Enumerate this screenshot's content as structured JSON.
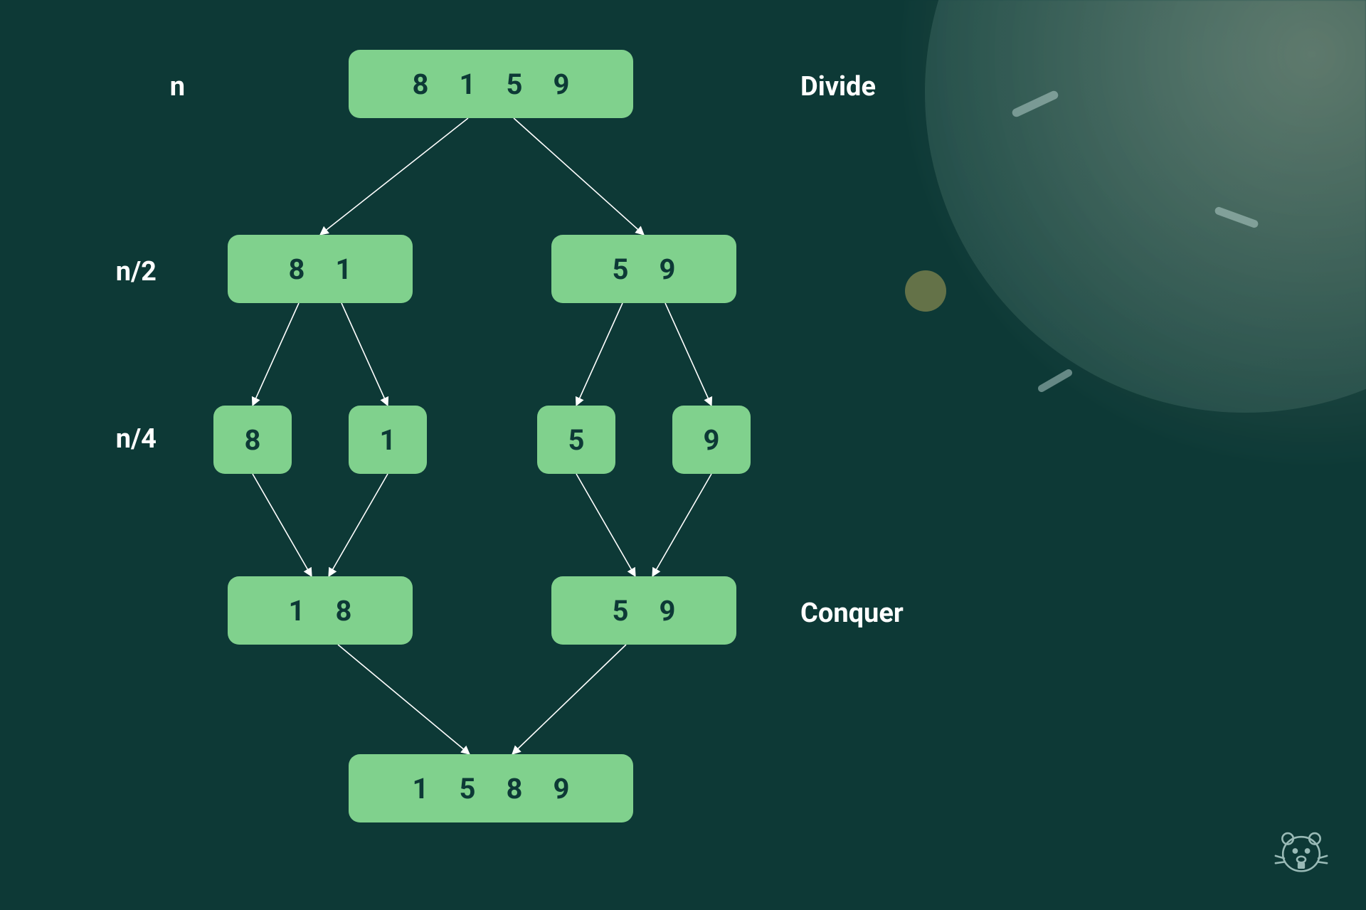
{
  "labels": {
    "level0": "n",
    "level1": "n/2",
    "level2": "n/4",
    "phase_divide": "Divide",
    "phase_conquer": "Conquer"
  },
  "nodes": {
    "root": {
      "values": [
        "8",
        "1",
        "5",
        "9"
      ]
    },
    "l1_left": {
      "values": [
        "8",
        "1"
      ]
    },
    "l1_right": {
      "values": [
        "5",
        "9"
      ]
    },
    "l2_a": {
      "values": [
        "8"
      ]
    },
    "l2_b": {
      "values": [
        "1"
      ]
    },
    "l2_c": {
      "values": [
        "5"
      ]
    },
    "l2_d": {
      "values": [
        "9"
      ]
    },
    "m1_left": {
      "values": [
        "1",
        "8"
      ]
    },
    "m1_right": {
      "values": [
        "5",
        "9"
      ]
    },
    "final": {
      "values": [
        "1",
        "5",
        "8",
        "9"
      ]
    }
  },
  "colors": {
    "background": "#0d3936",
    "node_bg": "#80d18d",
    "node_text": "#0d3936",
    "label_text": "#ffffff",
    "arrow": "#ffffff"
  },
  "icons": {
    "logo": "beaver-mascot-icon"
  }
}
